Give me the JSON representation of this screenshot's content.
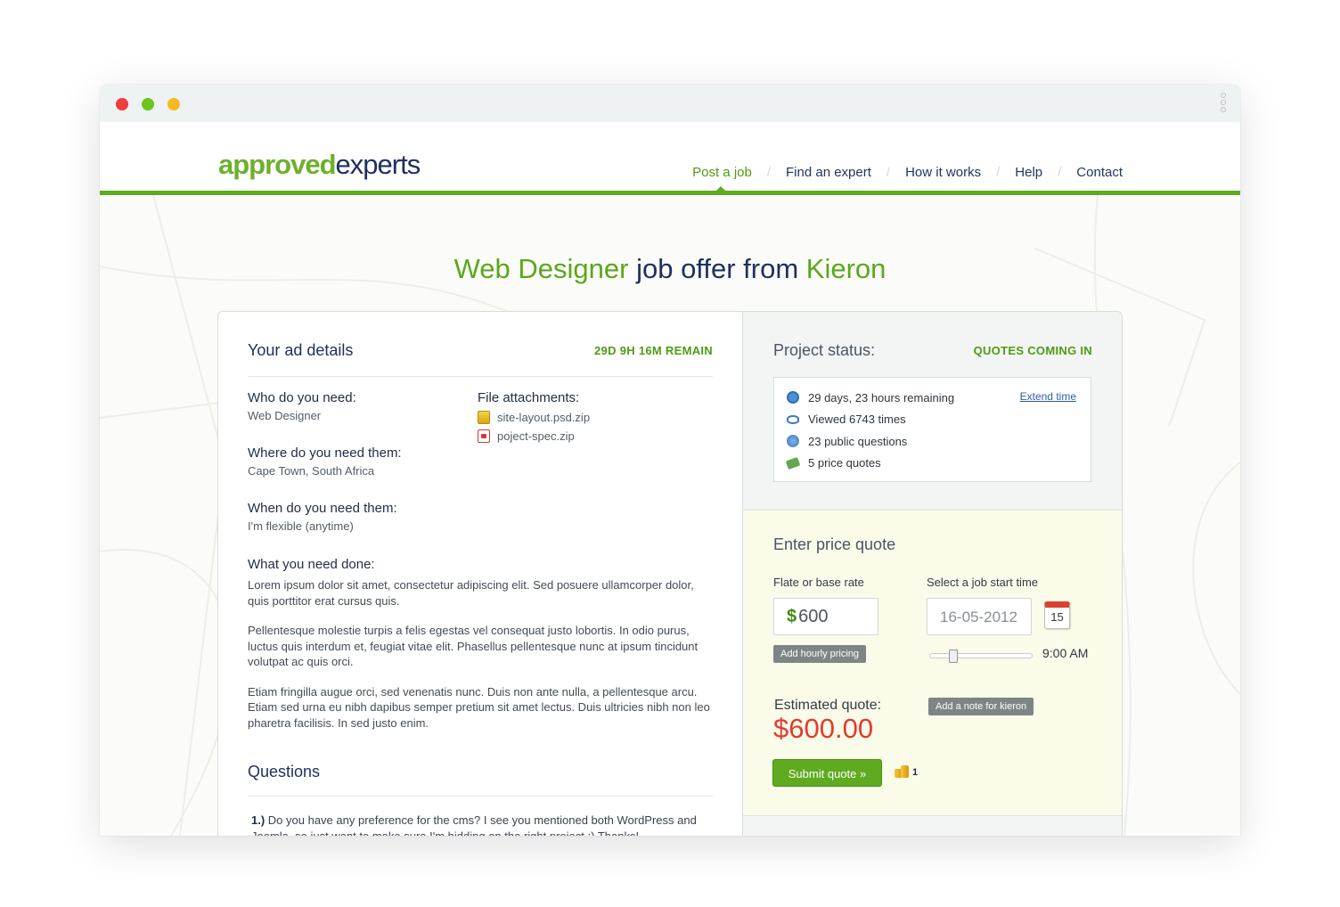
{
  "window": {
    "controls": [
      "close",
      "minimize",
      "maximize"
    ]
  },
  "logo": {
    "part1": "approved",
    "part2": "experts"
  },
  "nav": [
    {
      "label": "Post a job",
      "active": true
    },
    {
      "label": "Find an expert"
    },
    {
      "label": "How it works"
    },
    {
      "label": "Help"
    },
    {
      "label": "Contact"
    }
  ],
  "headline": {
    "role": "Web Designer",
    "middle": " job offer from ",
    "name": "Kieron"
  },
  "ad": {
    "title": "Your ad details",
    "remaining": "29D 9H 16M REMAIN",
    "who_label": "Who do you need:",
    "who_value": "Web Designer",
    "where_label": "Where do you need them:",
    "where_value": "Cape Town, South Africa",
    "when_label": "When do you need them:",
    "when_value": "I'm flexible (anytime)",
    "attachments_label": "File attachments:",
    "attachments": [
      "site-layout.psd.zip",
      "poject-spec.zip"
    ],
    "done_label": "What you need done:",
    "paragraphs": [
      "Lorem ipsum dolor sit amet, consectetur adipiscing elit. Sed posuere ullamcorper dolor, quis porttitor erat cursus quis.",
      "Pellentesque molestie turpis a felis egestas vel consequat justo lobortis. In odio purus, luctus quis interdum et, feugiat vitae elit. Phasellus pellentesque nunc at ipsum tincidunt volutpat ac quis orci.",
      "Etiam fringilla augue orci, sed venenatis nunc. Duis non ante nulla, a pellentesque arcu. Etiam sed urna eu nibh dapibus semper pretium sit amet lectus. Duis ultricies nibh non leo pharetra facilisis. In sed justo enim."
    ],
    "questions_title": "Questions",
    "question_num": "1.)",
    "question_text": "Do you have any preference for the cms? I see you mentioned both WordPress and Joomla, so just want to make sure I'm bidding on the right project :) Thanks!"
  },
  "status": {
    "title": "Project status:",
    "badge": "QUOTES COMING IN",
    "rows": [
      {
        "icon": "clock-icon",
        "text": "29 days, 23 hours remaining"
      },
      {
        "icon": "eye-icon",
        "text": "Viewed 6743 times"
      },
      {
        "icon": "help-icon",
        "text": "23 public questions"
      },
      {
        "icon": "money-icon",
        "text": "5 price quotes"
      }
    ],
    "extend_link": "Extend time"
  },
  "quote": {
    "title": "Enter price quote",
    "rate_label": "Flate or base rate",
    "currency_symbol": "$",
    "rate_value": "600",
    "hourly_button": "Add hourly pricing",
    "start_label": "Select a job start time",
    "date_value": "16-05-2012",
    "calendar_day": "15",
    "time_value": "9:00 AM",
    "time_slider_fraction": 0.2,
    "estimated_label": "Estimated quote:",
    "estimated_value": "$600.00",
    "note_button": "Add a note for kieron",
    "submit": "Submit quote »",
    "coin_count": "1"
  },
  "colors": {
    "accent": "#5eab1f",
    "navy": "#1f3060",
    "price": "#e23b2e"
  }
}
